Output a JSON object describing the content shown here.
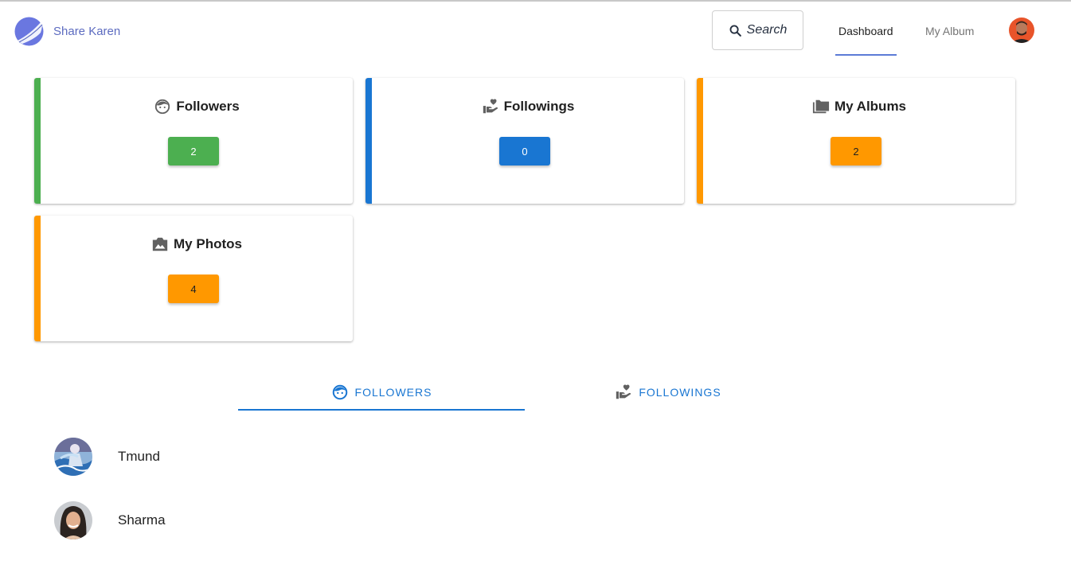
{
  "header": {
    "brand": "Share Karen",
    "search_label": "Search",
    "nav": [
      {
        "label": "Dashboard",
        "active": true
      },
      {
        "label": "My Album",
        "active": false
      }
    ]
  },
  "stats": [
    {
      "title": "Followers",
      "count": "2",
      "icon": "face-icon",
      "color": "#4caf50"
    },
    {
      "title": "Followings",
      "count": "0",
      "icon": "volunteer-heart-icon",
      "color": "#1976d2"
    },
    {
      "title": "My Albums",
      "count": "2",
      "icon": "folders-icon",
      "color": "#ff9800"
    },
    {
      "title": "My Photos",
      "count": "4",
      "icon": "camera-photo-icon",
      "color": "#ff9800"
    }
  ],
  "tabs": [
    {
      "label": "FOLLOWERS",
      "icon": "face-icon",
      "active": true
    },
    {
      "label": "FOLLOWINGS",
      "icon": "volunteer-heart-icon",
      "active": false
    }
  ],
  "followers": [
    {
      "name": "Tmund"
    },
    {
      "name": "Sharma"
    }
  ],
  "colors": {
    "brand": "#5c6bc0",
    "tab_accent": "#1976d2",
    "green": "#4caf50",
    "blue": "#1976d2",
    "orange": "#ff9800"
  }
}
